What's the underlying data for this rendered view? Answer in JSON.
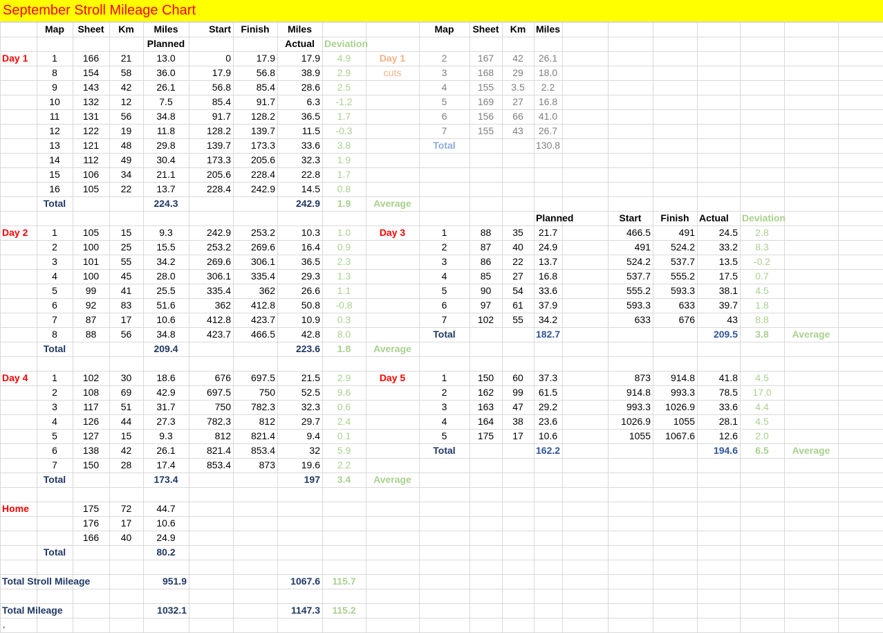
{
  "title": "September Stroll Mileage Chart",
  "colors": {
    "title_background": "#ffff00",
    "title_text": "#ff0000",
    "day_label": "#ff0000",
    "total_label": "#1f3864",
    "deviation": "#a9d08e",
    "cuts_label": "#f4b183",
    "cuts_values": "#7f7f7f",
    "cuts_total": "#8eaadb"
  },
  "headers": {
    "map": "Map",
    "sheet": "Sheet",
    "km": "Km",
    "miles": "Miles",
    "planned": "Planned",
    "start": "Start",
    "finish": "Finish",
    "actual": "Actual",
    "deviation": "Deviation"
  },
  "labels": {
    "total": "Total",
    "average": "Average",
    "home": "Home",
    "cuts": "cuts",
    "total_stroll_mileage": "Total Stroll Mileage",
    "total_mileage": "Total Mileage"
  },
  "day1": {
    "label": "Day 1",
    "rows": [
      {
        "map": "1",
        "sheet": "166",
        "km": "21",
        "planned": "13.0",
        "start": "0",
        "finish": "17.9",
        "actual": "17.9",
        "dev": "4.9"
      },
      {
        "map": "8",
        "sheet": "154",
        "km": "58",
        "planned": "36.0",
        "start": "17.9",
        "finish": "56.8",
        "actual": "38.9",
        "dev": "2.9"
      },
      {
        "map": "9",
        "sheet": "143",
        "km": "42",
        "planned": "26.1",
        "start": "56.8",
        "finish": "85.4",
        "actual": "28.6",
        "dev": "2.5"
      },
      {
        "map": "10",
        "sheet": "132",
        "km": "12",
        "planned": "7.5",
        "start": "85.4",
        "finish": "91.7",
        "actual": "6.3",
        "dev": "-1.2"
      },
      {
        "map": "11",
        "sheet": "131",
        "km": "56",
        "planned": "34.8",
        "start": "91.7",
        "finish": "128.2",
        "actual": "36.5",
        "dev": "1.7"
      },
      {
        "map": "12",
        "sheet": "122",
        "km": "19",
        "planned": "11.8",
        "start": "128.2",
        "finish": "139.7",
        "actual": "11.5",
        "dev": "-0.3"
      },
      {
        "map": "13",
        "sheet": "121",
        "km": "48",
        "planned": "29.8",
        "start": "139.7",
        "finish": "173.3",
        "actual": "33.6",
        "dev": "3.8"
      },
      {
        "map": "14",
        "sheet": "112",
        "km": "49",
        "planned": "30.4",
        "start": "173.3",
        "finish": "205.6",
        "actual": "32.3",
        "dev": "1.9"
      },
      {
        "map": "15",
        "sheet": "106",
        "km": "34",
        "planned": "21.1",
        "start": "205.6",
        "finish": "228.4",
        "actual": "22.8",
        "dev": "1.7"
      },
      {
        "map": "16",
        "sheet": "105",
        "km": "22",
        "planned": "13.7",
        "start": "228.4",
        "finish": "242.9",
        "actual": "14.5",
        "dev": "0.8"
      }
    ],
    "total_planned": "224.3",
    "total_actual": "242.9",
    "average_dev": "1.9"
  },
  "day1_cuts": {
    "label": "Day 1",
    "rows": [
      {
        "map": "2",
        "sheet": "167",
        "km": "42",
        "miles": "26.1"
      },
      {
        "map": "3",
        "sheet": "168",
        "km": "29",
        "miles": "18.0"
      },
      {
        "map": "4",
        "sheet": "155",
        "km": "3.5",
        "miles": "2.2"
      },
      {
        "map": "5",
        "sheet": "169",
        "km": "27",
        "miles": "16.8"
      },
      {
        "map": "6",
        "sheet": "156",
        "km": "66",
        "miles": "41.0"
      },
      {
        "map": "7",
        "sheet": "155",
        "km": "43",
        "miles": "26.7"
      }
    ],
    "total_miles": "130.8"
  },
  "day2": {
    "label": "Day 2",
    "rows": [
      {
        "map": "1",
        "sheet": "105",
        "km": "15",
        "planned": "9.3",
        "start": "242.9",
        "finish": "253.2",
        "actual": "10.3",
        "dev": "1.0"
      },
      {
        "map": "2",
        "sheet": "100",
        "km": "25",
        "planned": "15.5",
        "start": "253.2",
        "finish": "269.6",
        "actual": "16.4",
        "dev": "0.9"
      },
      {
        "map": "3",
        "sheet": "101",
        "km": "55",
        "planned": "34.2",
        "start": "269.6",
        "finish": "306.1",
        "actual": "36.5",
        "dev": "2.3"
      },
      {
        "map": "4",
        "sheet": "100",
        "km": "45",
        "planned": "28.0",
        "start": "306.1",
        "finish": "335.4",
        "actual": "29.3",
        "dev": "1.3"
      },
      {
        "map": "5",
        "sheet": "99",
        "km": "41",
        "planned": "25.5",
        "start": "335.4",
        "finish": "362",
        "actual": "26.6",
        "dev": "1.1"
      },
      {
        "map": "6",
        "sheet": "92",
        "km": "83",
        "planned": "51.6",
        "start": "362",
        "finish": "412.8",
        "actual": "50.8",
        "dev": "-0.8"
      },
      {
        "map": "7",
        "sheet": "87",
        "km": "17",
        "planned": "10.6",
        "start": "412.8",
        "finish": "423.7",
        "actual": "10.9",
        "dev": "0.3"
      },
      {
        "map": "8",
        "sheet": "88",
        "km": "56",
        "planned": "34.8",
        "start": "423.7",
        "finish": "466.5",
        "actual": "42.8",
        "dev": "8.0"
      }
    ],
    "total_planned": "209.4",
    "total_actual": "223.6",
    "average_dev": "1.8"
  },
  "day3": {
    "label": "Day 3",
    "rows": [
      {
        "map": "1",
        "sheet": "88",
        "km": "35",
        "planned": "21.7",
        "start": "466.5",
        "finish": "491",
        "actual": "24.5",
        "dev": "2.8"
      },
      {
        "map": "2",
        "sheet": "87",
        "km": "40",
        "planned": "24.9",
        "start": "491",
        "finish": "524.2",
        "actual": "33.2",
        "dev": "8.3"
      },
      {
        "map": "3",
        "sheet": "86",
        "km": "22",
        "planned": "13.7",
        "start": "524.2",
        "finish": "537.7",
        "actual": "13.5",
        "dev": "-0.2"
      },
      {
        "map": "4",
        "sheet": "85",
        "km": "27",
        "planned": "16.8",
        "start": "537.7",
        "finish": "555.2",
        "actual": "17.5",
        "dev": "0.7"
      },
      {
        "map": "5",
        "sheet": "90",
        "km": "54",
        "planned": "33.6",
        "start": "555.2",
        "finish": "593.3",
        "actual": "38.1",
        "dev": "4.5"
      },
      {
        "map": "6",
        "sheet": "97",
        "km": "61",
        "planned": "37.9",
        "start": "593.3",
        "finish": "633",
        "actual": "39.7",
        "dev": "1.8"
      },
      {
        "map": "7",
        "sheet": "102",
        "km": "55",
        "planned": "34.2",
        "start": "633",
        "finish": "676",
        "actual": "43",
        "dev": "8.8"
      }
    ],
    "total_planned": "182.7",
    "total_actual": "209.5",
    "average_dev": "3.8"
  },
  "day4": {
    "label": "Day 4",
    "rows": [
      {
        "map": "1",
        "sheet": "102",
        "km": "30",
        "planned": "18.6",
        "start": "676",
        "finish": "697.5",
        "actual": "21.5",
        "dev": "2.9"
      },
      {
        "map": "2",
        "sheet": "108",
        "km": "69",
        "planned": "42.9",
        "start": "697.5",
        "finish": "750",
        "actual": "52.5",
        "dev": "9.6"
      },
      {
        "map": "3",
        "sheet": "117",
        "km": "51",
        "planned": "31.7",
        "start": "750",
        "finish": "782.3",
        "actual": "32.3",
        "dev": "0.6"
      },
      {
        "map": "4",
        "sheet": "126",
        "km": "44",
        "planned": "27.3",
        "start": "782.3",
        "finish": "812",
        "actual": "29.7",
        "dev": "2.4"
      },
      {
        "map": "5",
        "sheet": "127",
        "km": "15",
        "planned": "9.3",
        "start": "812",
        "finish": "821.4",
        "actual": "9.4",
        "dev": "0.1"
      },
      {
        "map": "6",
        "sheet": "138",
        "km": "42",
        "planned": "26.1",
        "start": "821.4",
        "finish": "853.4",
        "actual": "32",
        "dev": "5.9"
      },
      {
        "map": "7",
        "sheet": "150",
        "km": "28",
        "planned": "17.4",
        "start": "853.4",
        "finish": "873",
        "actual": "19.6",
        "dev": "2.2"
      }
    ],
    "total_planned": "173.4",
    "total_actual": "197",
    "average_dev": "3.4"
  },
  "day5": {
    "label": "Day 5",
    "rows": [
      {
        "map": "1",
        "sheet": "150",
        "km": "60",
        "planned": "37.3",
        "start": "873",
        "finish": "914.8",
        "actual": "41.8",
        "dev": "4.5"
      },
      {
        "map": "2",
        "sheet": "162",
        "km": "99",
        "planned": "61.5",
        "start": "914.8",
        "finish": "993.3",
        "actual": "78.5",
        "dev": "17.0"
      },
      {
        "map": "3",
        "sheet": "163",
        "km": "47",
        "planned": "29.2",
        "start": "993.3",
        "finish": "1026.9",
        "actual": "33.6",
        "dev": "4.4"
      },
      {
        "map": "4",
        "sheet": "164",
        "km": "38",
        "planned": "23.6",
        "start": "1026.9",
        "finish": "1055",
        "actual": "28.1",
        "dev": "4.5"
      },
      {
        "map": "5",
        "sheet": "175",
        "km": "17",
        "planned": "10.6",
        "start": "1055",
        "finish": "1067.6",
        "actual": "12.6",
        "dev": "2.0"
      }
    ],
    "total_planned": "162.2",
    "total_actual": "194.6",
    "average_dev": "6.5"
  },
  "home": {
    "label": "Home",
    "rows": [
      {
        "sheet": "175",
        "km": "72",
        "miles": "44.7"
      },
      {
        "sheet": "176",
        "km": "17",
        "miles": "10.6"
      },
      {
        "sheet": "166",
        "km": "40",
        "miles": "24.9"
      }
    ],
    "total_miles": "80.2"
  },
  "totals": {
    "stroll_planned": "951.9",
    "stroll_actual": "1067.6",
    "stroll_dev": "115.7",
    "mileage_planned": "1032.1",
    "mileage_actual": "1147.3",
    "mileage_dev": "115.2"
  },
  "footer_mark": ","
}
